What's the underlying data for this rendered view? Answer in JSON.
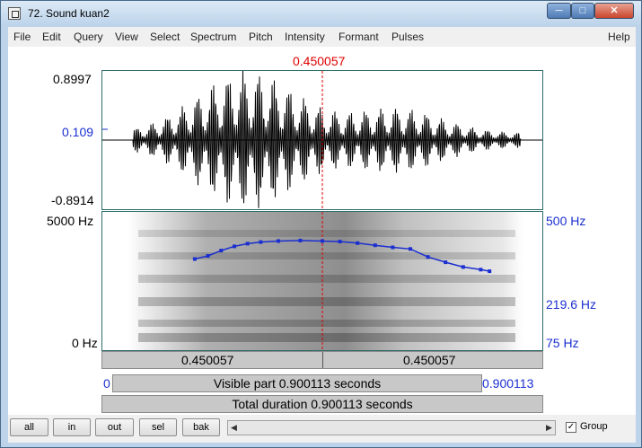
{
  "window": {
    "title": "72. Sound kuan2"
  },
  "menu": [
    "File",
    "Edit",
    "Query",
    "View",
    "Select",
    "Spectrum",
    "Pitch",
    "Intensity",
    "Formant",
    "Pulses",
    "Help"
  ],
  "cursor": {
    "time_label": "0.450057"
  },
  "waveform": {
    "ymax_label": "0.8997",
    "ymin_label": "-0.8914",
    "cursor_value_label": "0.109"
  },
  "spectrogram": {
    "fmax_label": "5000 Hz",
    "fmin_label": "0 Hz"
  },
  "pitch": {
    "max_label": "500 Hz",
    "current_label": "219.6 Hz",
    "min_label": "75 Hz",
    "contour": [
      [
        0.21,
        172
      ],
      [
        0.24,
        178
      ],
      [
        0.27,
        188
      ],
      [
        0.3,
        196
      ],
      [
        0.33,
        201
      ],
      [
        0.36,
        204
      ],
      [
        0.4,
        206
      ],
      [
        0.45,
        207
      ],
      [
        0.5,
        206
      ],
      [
        0.54,
        205
      ],
      [
        0.58,
        202
      ],
      [
        0.62,
        198
      ],
      [
        0.66,
        194
      ],
      [
        0.7,
        191
      ],
      [
        0.74,
        176
      ],
      [
        0.78,
        166
      ],
      [
        0.82,
        157
      ],
      [
        0.86,
        152
      ],
      [
        0.88,
        149
      ]
    ]
  },
  "time_bar": {
    "left": "0.450057",
    "right": "0.450057"
  },
  "visible_bar": {
    "start": "0",
    "text": "Visible part 0.900113 seconds",
    "end": "0.900113"
  },
  "total_bar": {
    "text": "Total duration 0.900113 seconds"
  },
  "buttons": {
    "all": "all",
    "in": "in",
    "out": "out",
    "sel": "sel",
    "bak": "bak"
  },
  "group": {
    "label": "Group",
    "checked": true
  }
}
